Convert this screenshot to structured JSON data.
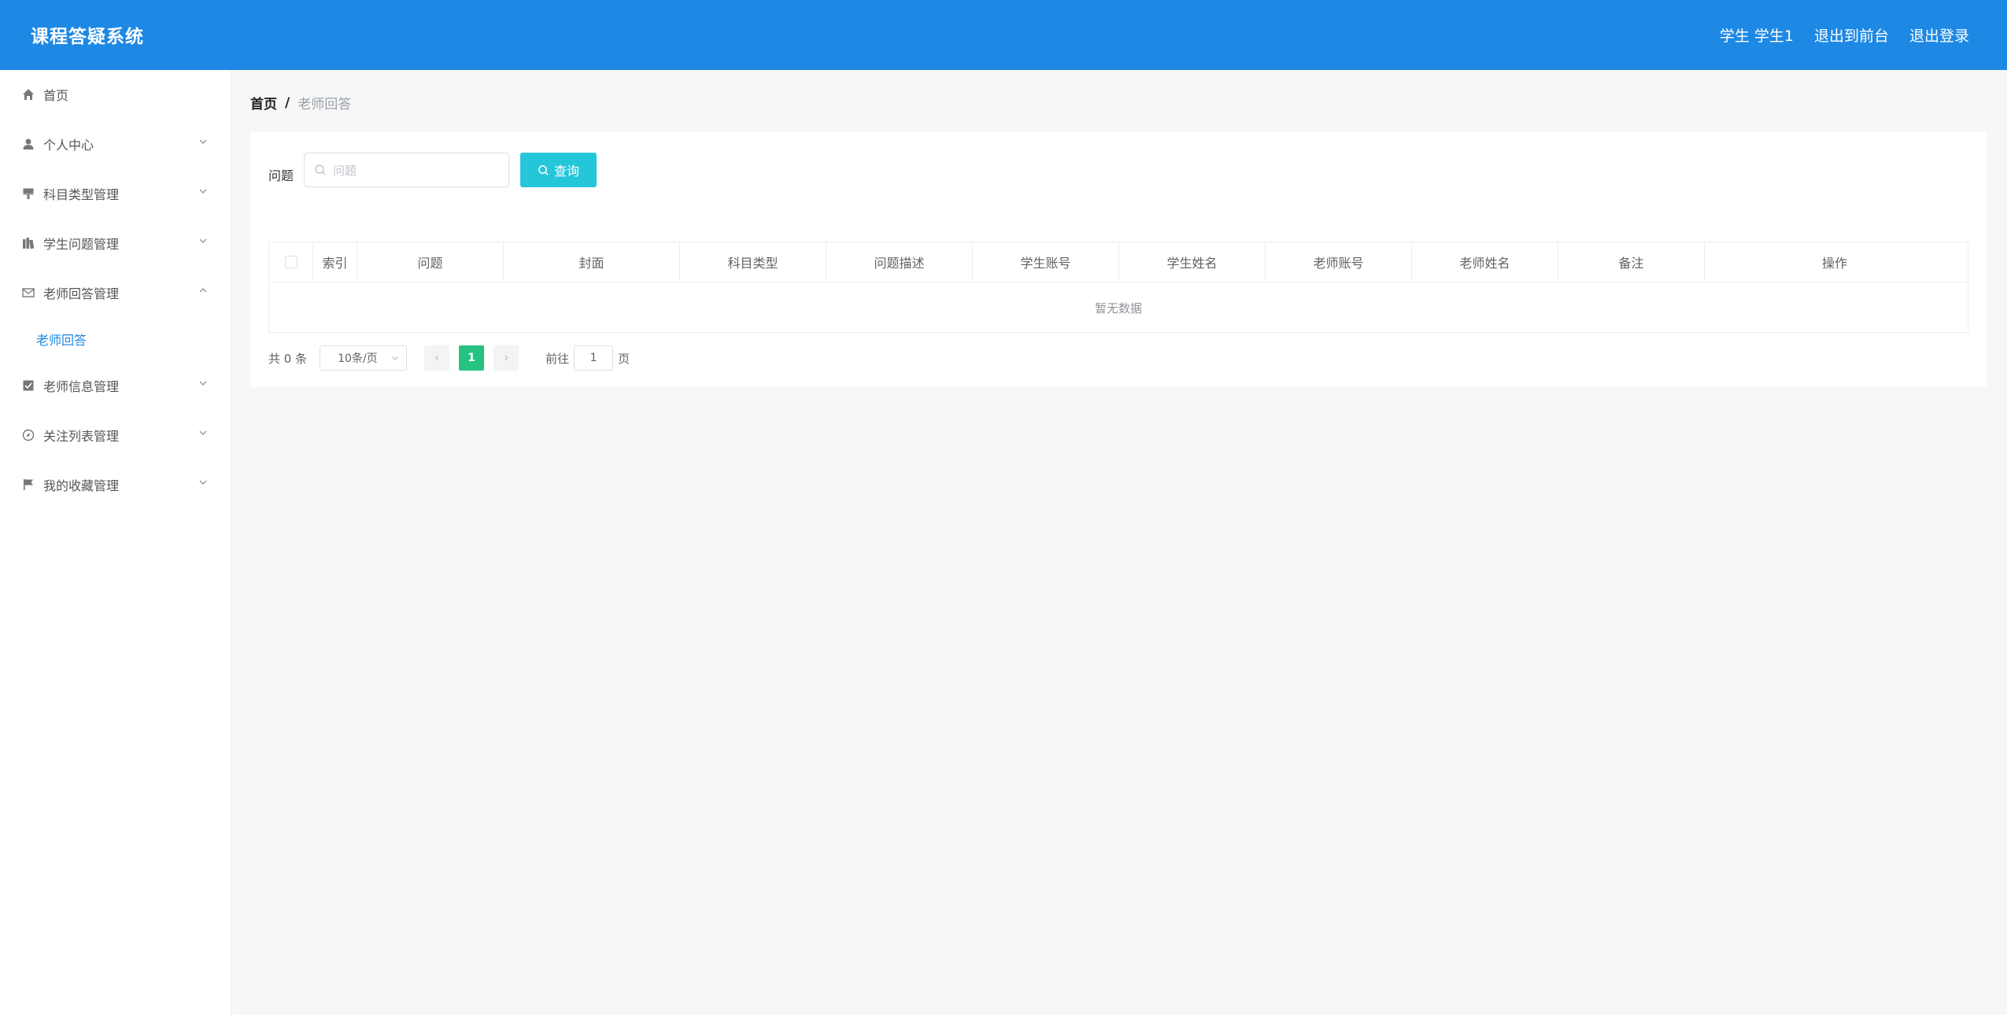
{
  "app": {
    "title": "课程答疑系统"
  },
  "header": {
    "user": "学生 学生1",
    "to_front": "退出到前台",
    "logout": "退出登录"
  },
  "sidebar": {
    "items": [
      {
        "label": "首页",
        "icon": "home-icon",
        "expandable": false
      },
      {
        "label": "个人中心",
        "icon": "user-icon",
        "expandable": true
      },
      {
        "label": "科目类型管理",
        "icon": "brush-icon",
        "expandable": true
      },
      {
        "label": "学生问题管理",
        "icon": "books-icon",
        "expandable": true
      },
      {
        "label": "老师回答管理",
        "icon": "mail-icon",
        "expandable": true,
        "expanded": true,
        "children": [
          {
            "label": "老师回答",
            "active": true
          }
        ]
      },
      {
        "label": "老师信息管理",
        "icon": "checkbox-icon",
        "expandable": true
      },
      {
        "label": "关注列表管理",
        "icon": "compass-icon",
        "expandable": true
      },
      {
        "label": "我的收藏管理",
        "icon": "flag-icon",
        "expandable": true
      }
    ]
  },
  "breadcrumb": {
    "home": "首页",
    "separator": "/",
    "current": "老师回答"
  },
  "search": {
    "label": "问题",
    "placeholder": "问题",
    "value": "",
    "button": "查询"
  },
  "table": {
    "columns": [
      "索引",
      "问题",
      "封面",
      "科目类型",
      "问题描述",
      "学生账号",
      "学生姓名",
      "老师账号",
      "老师姓名",
      "备注",
      "操作"
    ],
    "rows": [],
    "empty_text": "暂无数据"
  },
  "pagination": {
    "total_text": "共 0 条",
    "page_size": "10条/页",
    "current_page": "1",
    "goto_label": "前往",
    "goto_value": "1",
    "page_suffix": "页"
  },
  "colors": {
    "header": "#1e88e5",
    "accent": "#26c6da",
    "page_active": "#26c281",
    "menu_active_text": "#1e88e5"
  }
}
